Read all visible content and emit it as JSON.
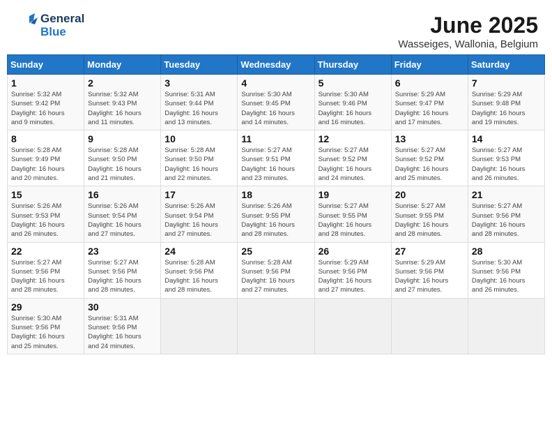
{
  "header": {
    "logo_general": "General",
    "logo_blue": "Blue",
    "title": "June 2025",
    "subtitle": "Wasseiges, Wallonia, Belgium"
  },
  "calendar": {
    "days_of_week": [
      "Sunday",
      "Monday",
      "Tuesday",
      "Wednesday",
      "Thursday",
      "Friday",
      "Saturday"
    ],
    "weeks": [
      [
        null,
        null,
        null,
        null,
        null,
        null,
        null
      ]
    ]
  },
  "cells": {
    "week1": [
      {
        "day": null,
        "info": null
      },
      {
        "day": null,
        "info": null
      },
      {
        "day": "1",
        "info": "Sunrise: 5:32 AM\nSunset: 9:42 PM\nDaylight: 16 hours\nand 9 minutes."
      },
      {
        "day": "2",
        "info": "Sunrise: 5:32 AM\nSunset: 9:43 PM\nDaylight: 16 hours\nand 11 minutes."
      },
      {
        "day": "3",
        "info": "Sunrise: 5:31 AM\nSunset: 9:44 PM\nDaylight: 16 hours\nand 13 minutes."
      },
      {
        "day": "4",
        "info": "Sunrise: 5:30 AM\nSunset: 9:45 PM\nDaylight: 16 hours\nand 14 minutes."
      },
      {
        "day": "5",
        "info": "Sunrise: 5:30 AM\nSunset: 9:46 PM\nDaylight: 16 hours\nand 16 minutes."
      },
      {
        "day": "6",
        "info": "Sunrise: 5:29 AM\nSunset: 9:47 PM\nDaylight: 16 hours\nand 17 minutes."
      },
      {
        "day": "7",
        "info": "Sunrise: 5:29 AM\nSunset: 9:48 PM\nDaylight: 16 hours\nand 19 minutes."
      }
    ],
    "week2": [
      {
        "day": "8",
        "info": "Sunrise: 5:28 AM\nSunset: 9:49 PM\nDaylight: 16 hours\nand 20 minutes."
      },
      {
        "day": "9",
        "info": "Sunrise: 5:28 AM\nSunset: 9:50 PM\nDaylight: 16 hours\nand 21 minutes."
      },
      {
        "day": "10",
        "info": "Sunrise: 5:28 AM\nSunset: 9:50 PM\nDaylight: 16 hours\nand 22 minutes."
      },
      {
        "day": "11",
        "info": "Sunrise: 5:27 AM\nSunset: 9:51 PM\nDaylight: 16 hours\nand 23 minutes."
      },
      {
        "day": "12",
        "info": "Sunrise: 5:27 AM\nSunset: 9:52 PM\nDaylight: 16 hours\nand 24 minutes."
      },
      {
        "day": "13",
        "info": "Sunrise: 5:27 AM\nSunset: 9:52 PM\nDaylight: 16 hours\nand 25 minutes."
      },
      {
        "day": "14",
        "info": "Sunrise: 5:27 AM\nSunset: 9:53 PM\nDaylight: 16 hours\nand 26 minutes."
      }
    ],
    "week3": [
      {
        "day": "15",
        "info": "Sunrise: 5:26 AM\nSunset: 9:53 PM\nDaylight: 16 hours\nand 26 minutes."
      },
      {
        "day": "16",
        "info": "Sunrise: 5:26 AM\nSunset: 9:54 PM\nDaylight: 16 hours\nand 27 minutes."
      },
      {
        "day": "17",
        "info": "Sunrise: 5:26 AM\nSunset: 9:54 PM\nDaylight: 16 hours\nand 27 minutes."
      },
      {
        "day": "18",
        "info": "Sunrise: 5:26 AM\nSunset: 9:55 PM\nDaylight: 16 hours\nand 28 minutes."
      },
      {
        "day": "19",
        "info": "Sunrise: 5:27 AM\nSunset: 9:55 PM\nDaylight: 16 hours\nand 28 minutes."
      },
      {
        "day": "20",
        "info": "Sunrise: 5:27 AM\nSunset: 9:55 PM\nDaylight: 16 hours\nand 28 minutes."
      },
      {
        "day": "21",
        "info": "Sunrise: 5:27 AM\nSunset: 9:56 PM\nDaylight: 16 hours\nand 28 minutes."
      }
    ],
    "week4": [
      {
        "day": "22",
        "info": "Sunrise: 5:27 AM\nSunset: 9:56 PM\nDaylight: 16 hours\nand 28 minutes."
      },
      {
        "day": "23",
        "info": "Sunrise: 5:27 AM\nSunset: 9:56 PM\nDaylight: 16 hours\nand 28 minutes."
      },
      {
        "day": "24",
        "info": "Sunrise: 5:28 AM\nSunset: 9:56 PM\nDaylight: 16 hours\nand 28 minutes."
      },
      {
        "day": "25",
        "info": "Sunrise: 5:28 AM\nSunset: 9:56 PM\nDaylight: 16 hours\nand 27 minutes."
      },
      {
        "day": "26",
        "info": "Sunrise: 5:29 AM\nSunset: 9:56 PM\nDaylight: 16 hours\nand 27 minutes."
      },
      {
        "day": "27",
        "info": "Sunrise: 5:29 AM\nSunset: 9:56 PM\nDaylight: 16 hours\nand 27 minutes."
      },
      {
        "day": "28",
        "info": "Sunrise: 5:30 AM\nSunset: 9:56 PM\nDaylight: 16 hours\nand 26 minutes."
      }
    ],
    "week5": [
      {
        "day": "29",
        "info": "Sunrise: 5:30 AM\nSunset: 9:56 PM\nDaylight: 16 hours\nand 25 minutes."
      },
      {
        "day": "30",
        "info": "Sunrise: 5:31 AM\nSunset: 9:56 PM\nDaylight: 16 hours\nand 24 minutes."
      },
      {
        "day": null,
        "info": null
      },
      {
        "day": null,
        "info": null
      },
      {
        "day": null,
        "info": null
      },
      {
        "day": null,
        "info": null
      },
      {
        "day": null,
        "info": null
      }
    ]
  }
}
